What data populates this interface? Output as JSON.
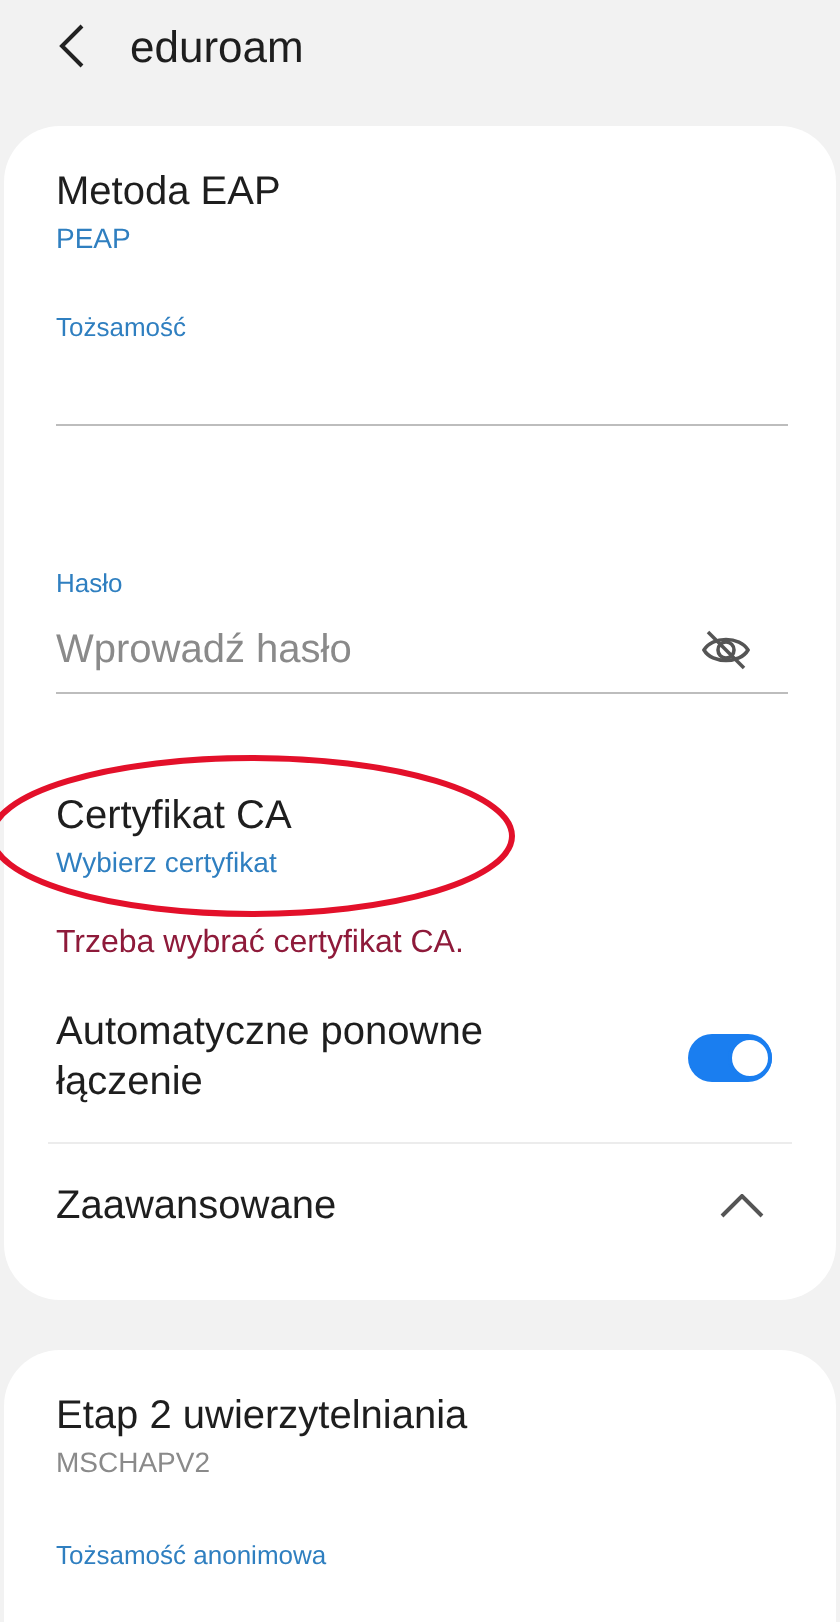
{
  "header": {
    "title": "eduroam"
  },
  "eap_method": {
    "label": "Metoda EAP",
    "value": "PEAP"
  },
  "identity": {
    "label": "Tożsamość"
  },
  "password": {
    "label": "Hasło",
    "placeholder": "Wprowadź hasło",
    "visible": false
  },
  "ca_certificate": {
    "label": "Certyfikat CA",
    "value": "Wybierz certyfikat",
    "error": "Trzeba wybrać certyfikat CA."
  },
  "auto_reconnect": {
    "label": "Automatyczne ponowne łączenie",
    "on": true
  },
  "advanced": {
    "label": "Zaawansowane",
    "expanded": true
  },
  "phase2": {
    "label": "Etap 2 uwierzytelniania",
    "value": "MSCHAPV2"
  },
  "anonymous_identity": {
    "label": "Tożsamość anonimowa"
  },
  "annotation": {
    "kind": "ellipse"
  }
}
